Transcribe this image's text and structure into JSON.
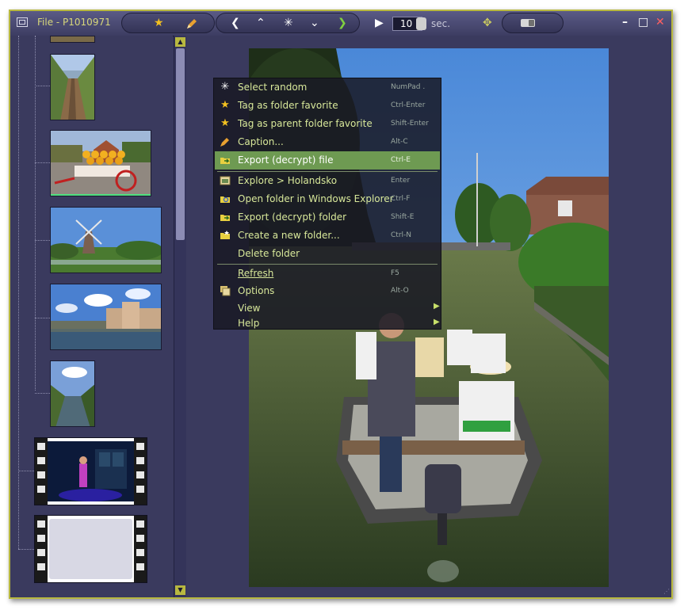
{
  "window": {
    "title": "File - P1010971",
    "slideshow_seconds": "10",
    "seconds_unit": "sec.",
    "controls": {
      "minimize": "–",
      "maximize": "□",
      "close": "✕"
    }
  },
  "toolbar": {
    "icons": [
      "star-icon",
      "pencil-icon",
      "chevron-left-icon",
      "chevron-up-icon",
      "random-icon",
      "chevron-down-icon",
      "chevron-right-icon",
      "play-icon",
      "stepper-icon",
      "move-icon",
      "toggle-icon"
    ]
  },
  "thumbnails": [
    {
      "kind": "photo",
      "subject": "narrow-path"
    },
    {
      "kind": "photo",
      "subject": "cheese-cart"
    },
    {
      "kind": "photo",
      "subject": "windmill"
    },
    {
      "kind": "photo",
      "subject": "canal-houses"
    },
    {
      "kind": "photo",
      "subject": "canal"
    },
    {
      "kind": "video",
      "subject": "concert"
    },
    {
      "kind": "video",
      "subject": "blank"
    }
  ],
  "context_menu": {
    "items": [
      {
        "label": "Select random",
        "shortcut": "NumPad .",
        "icon": "random-icon"
      },
      {
        "label": "Tag as folder favorite",
        "shortcut": "Ctrl-Enter",
        "icon": "star-icon"
      },
      {
        "label": "Tag as parent folder favorite",
        "shortcut": "Shift-Enter",
        "icon": "double-star-icon"
      },
      {
        "label": "Caption...",
        "shortcut": "Alt-C",
        "icon": "pencil-icon"
      },
      {
        "label": "Export (decrypt) file",
        "shortcut": "Ctrl-E",
        "icon": "folder-export-icon",
        "highlighted": true
      },
      {
        "label": "Explore > Holandsko",
        "shortcut": "Enter",
        "icon": "window-icon"
      },
      {
        "label": "Open folder in Windows Explorer",
        "shortcut": "Ctrl-F",
        "icon": "folder-search-icon"
      },
      {
        "label": "Export (decrypt) folder",
        "shortcut": "Shift-E",
        "icon": "folder-export-icon"
      },
      {
        "label": "Create a new folder...",
        "shortcut": "Ctrl-N",
        "icon": "folder-new-icon"
      },
      {
        "label": "Delete folder",
        "shortcut": "",
        "icon": ""
      },
      {
        "label": "Refresh",
        "shortcut": "F5",
        "icon": ""
      },
      {
        "label": "Options",
        "shortcut": "Alt-O",
        "icon": "options-icon"
      },
      {
        "label": "View",
        "shortcut": "",
        "icon": "",
        "submenu": true
      },
      {
        "label": "Help",
        "shortcut": "",
        "icon": "",
        "submenu": true
      }
    ]
  },
  "colors": {
    "background": "#3a3a5e",
    "accent": "#b8b840",
    "menu_text": "#d8e89a",
    "menu_highlight": "#6e9a52"
  }
}
